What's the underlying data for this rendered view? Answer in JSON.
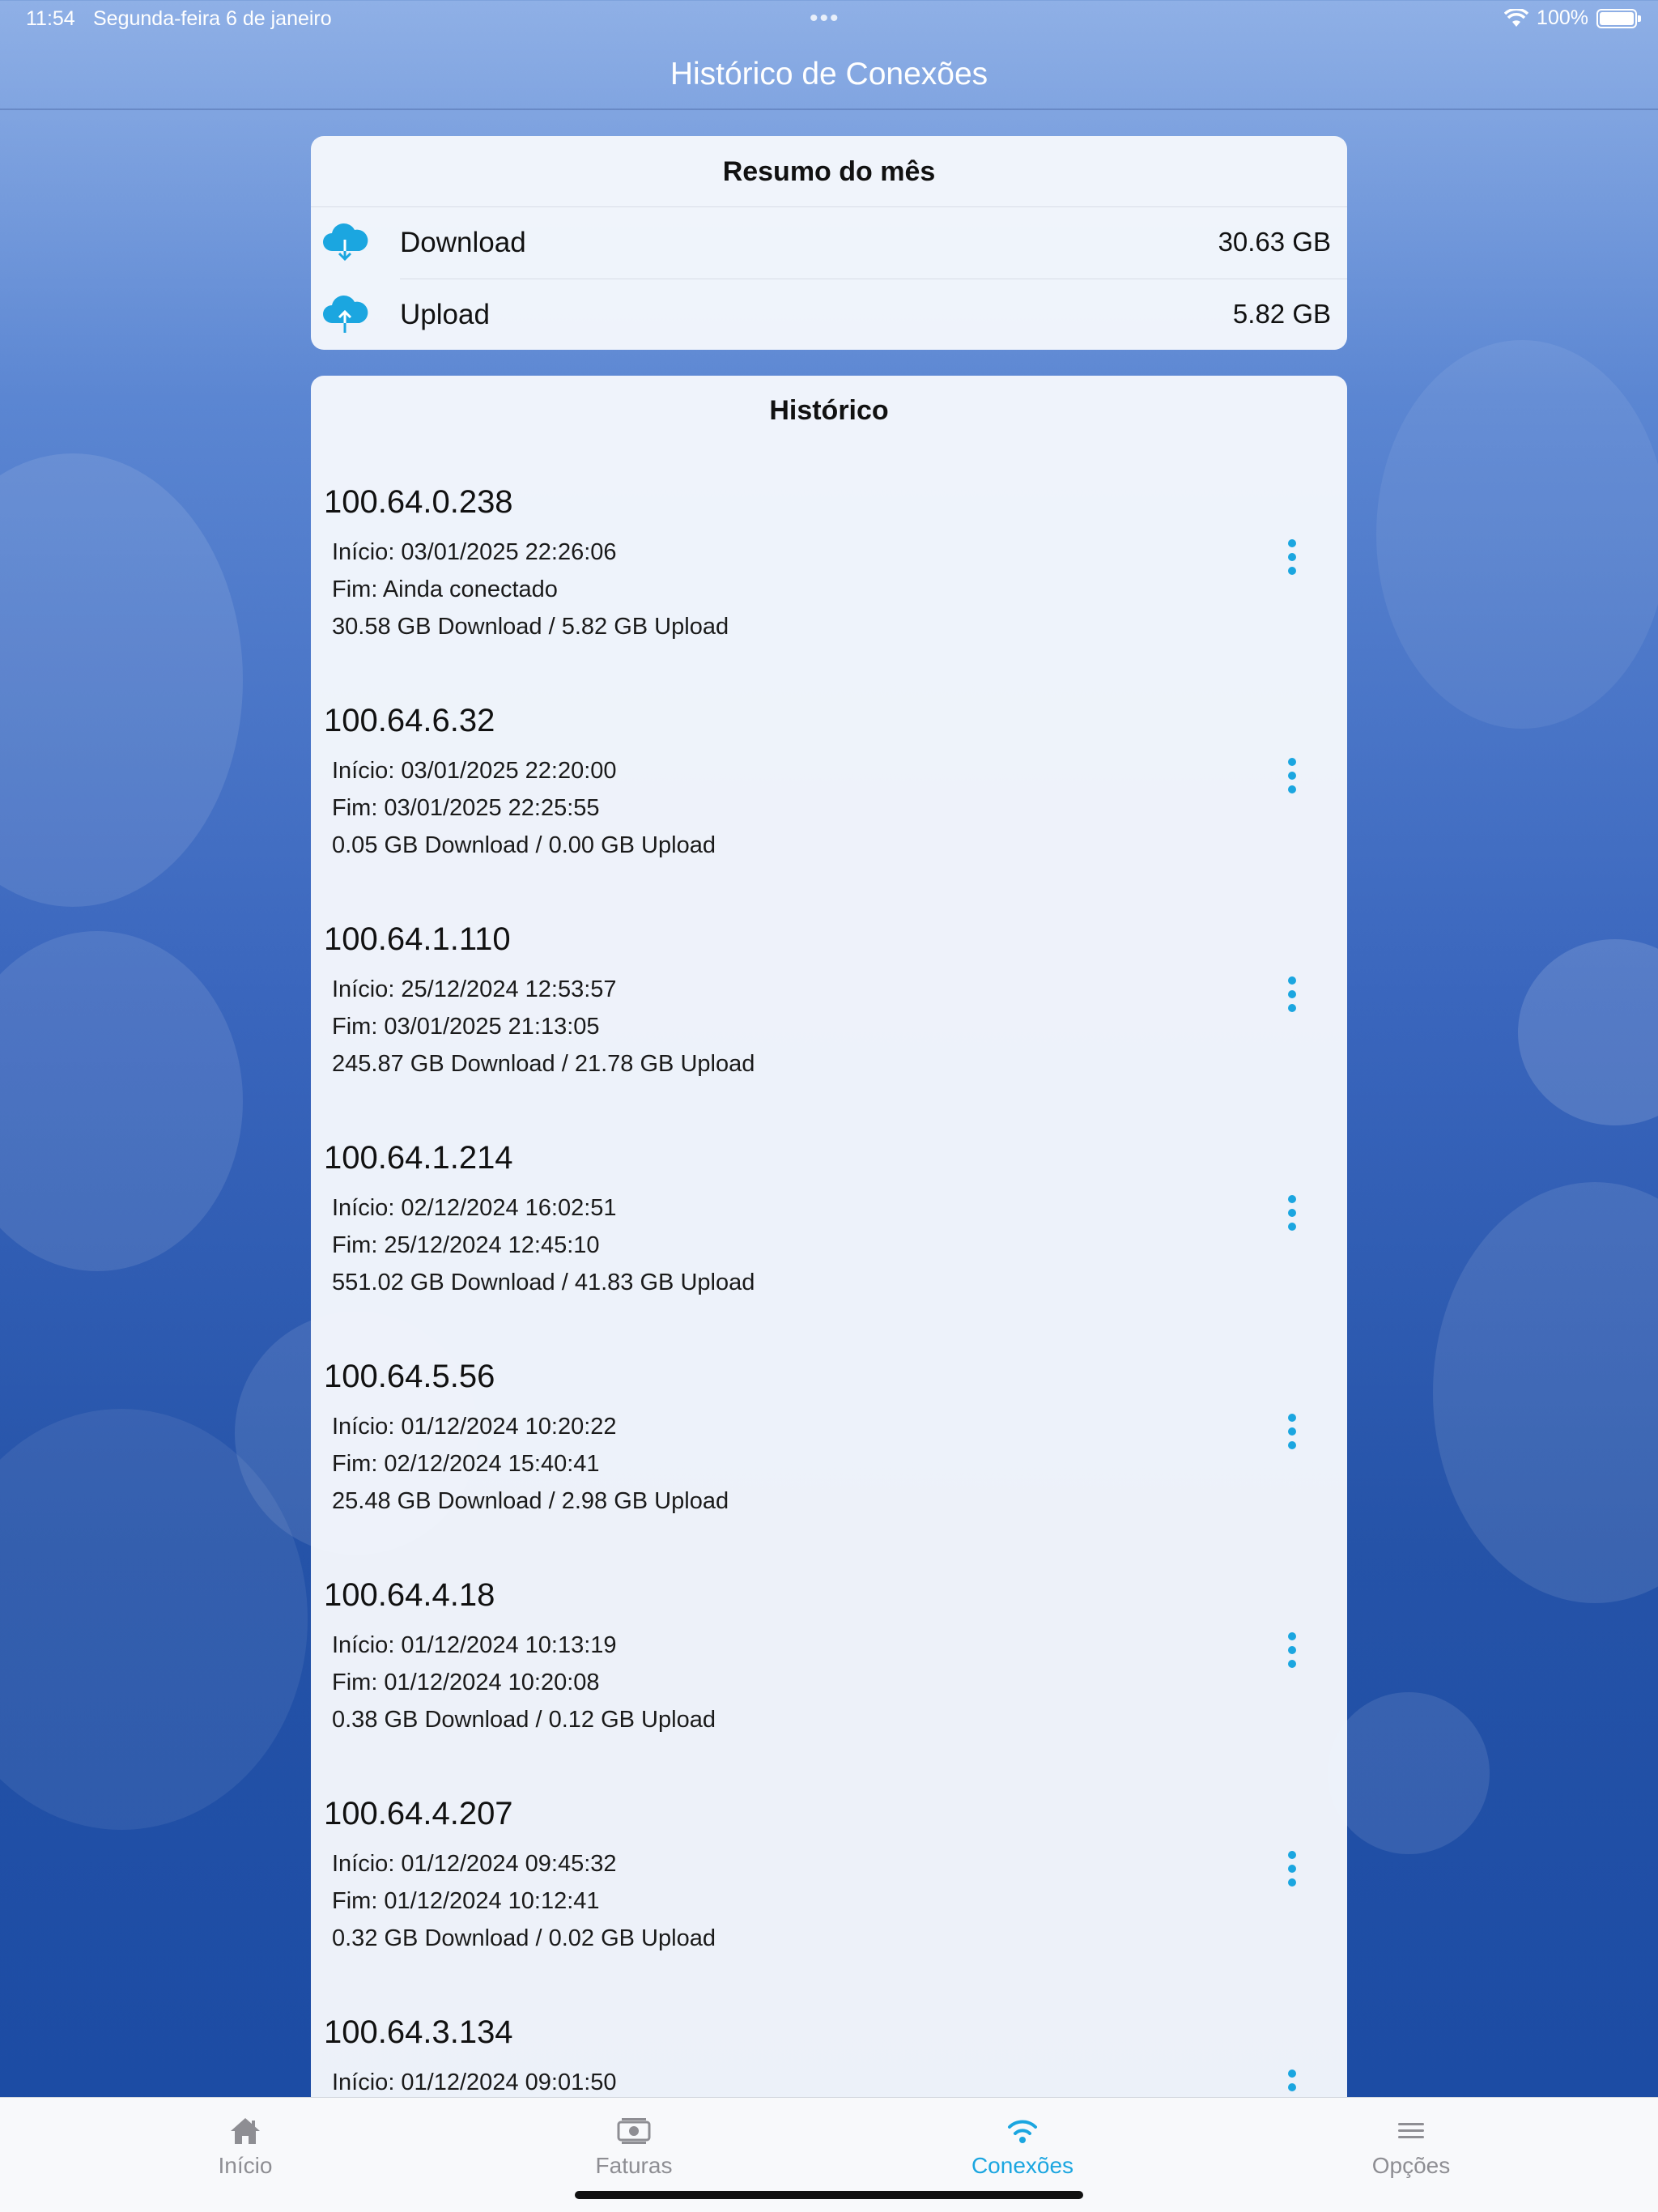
{
  "status_bar": {
    "time": "11:54",
    "date": "Segunda-feira 6 de janeiro",
    "battery": "100%"
  },
  "nav": {
    "title": "Histórico de Conexões"
  },
  "summary": {
    "title": "Resumo do mês",
    "rows": [
      {
        "label": "Download",
        "value": "30.63 GB",
        "icon": "cloud-download-icon"
      },
      {
        "label": "Upload",
        "value": "5.82 GB",
        "icon": "cloud-upload-icon"
      }
    ]
  },
  "history": {
    "title": "Histórico",
    "items": [
      {
        "ip": "100.64.0.238",
        "start": "Início: 03/01/2025 22:26:06",
        "end": "Fim: Ainda conectado",
        "usage": "30.58 GB Download / 5.82 GB Upload"
      },
      {
        "ip": "100.64.6.32",
        "start": "Início: 03/01/2025 22:20:00",
        "end": "Fim: 03/01/2025 22:25:55",
        "usage": "0.05 GB Download / 0.00 GB Upload"
      },
      {
        "ip": "100.64.1.110",
        "start": "Início: 25/12/2024 12:53:57",
        "end": "Fim: 03/01/2025 21:13:05",
        "usage": "245.87 GB Download / 21.78 GB Upload"
      },
      {
        "ip": "100.64.1.214",
        "start": "Início: 02/12/2024 16:02:51",
        "end": "Fim: 25/12/2024 12:45:10",
        "usage": "551.02 GB Download / 41.83 GB Upload"
      },
      {
        "ip": "100.64.5.56",
        "start": "Início: 01/12/2024 10:20:22",
        "end": "Fim: 02/12/2024 15:40:41",
        "usage": "25.48 GB Download / 2.98 GB Upload"
      },
      {
        "ip": "100.64.4.18",
        "start": "Início: 01/12/2024 10:13:19",
        "end": "Fim: 01/12/2024 10:20:08",
        "usage": "0.38 GB Download / 0.12 GB Upload"
      },
      {
        "ip": "100.64.4.207",
        "start": "Início: 01/12/2024 09:45:32",
        "end": "Fim: 01/12/2024 10:12:41",
        "usage": "0.32 GB Download / 0.02 GB Upload"
      },
      {
        "ip": "100.64.3.134",
        "start": "Início: 01/12/2024 09:01:50",
        "end": "",
        "usage": ""
      }
    ]
  },
  "tabs": [
    {
      "label": "Início",
      "icon": "house-icon"
    },
    {
      "label": "Faturas",
      "icon": "money-icon"
    },
    {
      "label": "Conexões",
      "icon": "wifi-icon",
      "active": true
    },
    {
      "label": "Opções",
      "icon": "menu-icon"
    }
  ],
  "colors": {
    "accent": "#1ba6e0",
    "inactive": "#8e8e93"
  }
}
